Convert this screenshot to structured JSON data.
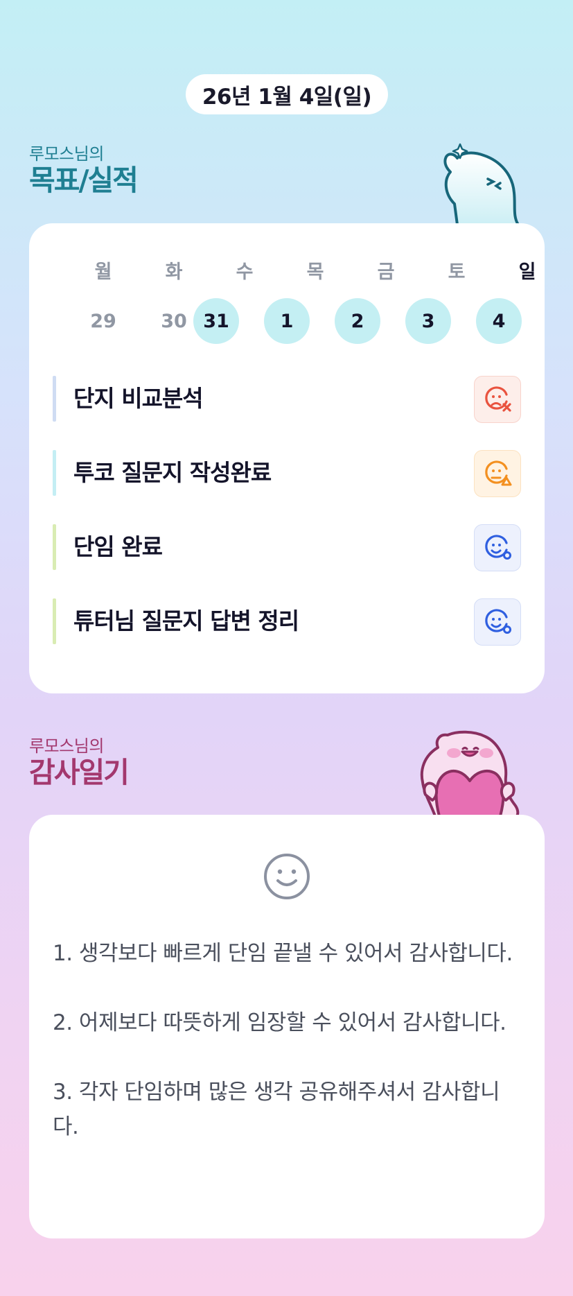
{
  "header": {
    "date": "26년 1월 4일(일)"
  },
  "goals_section": {
    "subtitle": "루모스님의",
    "title": "목표/실적",
    "week": [
      {
        "day": "월",
        "num": "29",
        "active": false,
        "today": false
      },
      {
        "day": "화",
        "num": "30",
        "active": false,
        "today": false
      },
      {
        "day": "수",
        "num": "31",
        "active": true,
        "today": false
      },
      {
        "day": "목",
        "num": "1",
        "active": true,
        "today": false
      },
      {
        "day": "금",
        "num": "2",
        "active": true,
        "today": false
      },
      {
        "day": "토",
        "num": "3",
        "active": true,
        "today": false
      },
      {
        "day": "일",
        "num": "4",
        "active": true,
        "today": true
      }
    ],
    "goals": [
      {
        "label": "단지 비교분석",
        "status": "x",
        "bar_color": "#cfdcf3",
        "icon": "sad-face-x-icon",
        "color": "#e9533f",
        "bg": "#fdeeea"
      },
      {
        "label": "투코 질문지 작성완료",
        "status": "triangle",
        "bar_color": "#c4eef4",
        "icon": "neutral-face-triangle-icon",
        "color": "#f39020",
        "bg": "#fff3e3"
      },
      {
        "label": "단임 완료",
        "status": "o",
        "bar_color": "#d9ecb3",
        "icon": "happy-face-o-icon",
        "color": "#2f5fe0",
        "bg": "#edf1fd"
      },
      {
        "label": "튜터님 질문지 답변 정리",
        "status": "o",
        "bar_color": "#d9ecb3",
        "icon": "happy-face-o-icon",
        "color": "#2f5fe0",
        "bg": "#edf1fd"
      }
    ]
  },
  "thanks_section": {
    "subtitle": "루모스님의",
    "title": "감사일기",
    "icon": "smiley-icon",
    "entries": [
      "1. 생각보다 빠르게 단임 끝낼 수 있어서 감사합니다.",
      "2. 어제보다 따뜻하게 임장할 수 있어서 감사합니다.",
      "3. 각자 단임하며 많은 생각 공유해주셔서 감사합니다."
    ]
  },
  "colors": {
    "goals_accent": "#1f7f92",
    "thanks_accent": "#a3386e",
    "active_day_bg": "#c4eff3"
  }
}
